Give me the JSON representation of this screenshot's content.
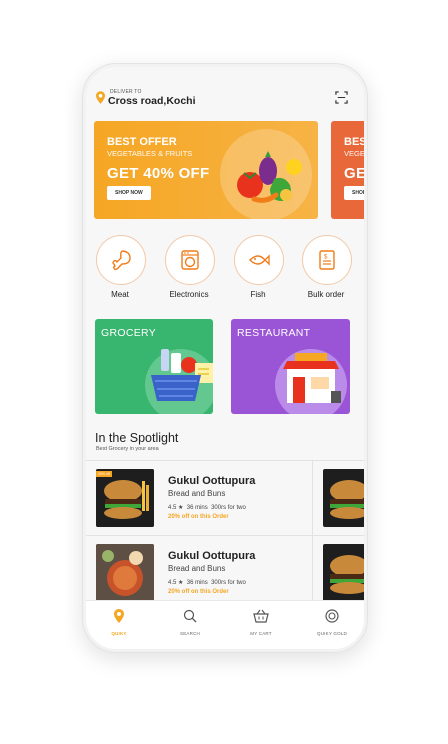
{
  "header": {
    "deliver_label": "DELIVER TO",
    "location": "Cross road,Kochi",
    "pin_icon": "location-pin-icon",
    "scan_icon": "scan-icon"
  },
  "banners": [
    {
      "title": "BEST OFFER",
      "subtitle": "VEGETABLES & FRUITS",
      "discount": "GET 40% OFF",
      "button": "SHOP NOW",
      "color": "#f5a623"
    },
    {
      "title": "BES",
      "subtitle": "VEGE",
      "discount": "GE",
      "button": "SHOP",
      "color": "#e8683a"
    }
  ],
  "categories": [
    {
      "label": "Meat",
      "icon": "drumstick-icon"
    },
    {
      "label": "Electronics",
      "icon": "washing-machine-icon"
    },
    {
      "label": "Fish",
      "icon": "fish-icon"
    },
    {
      "label": "Bulk order",
      "icon": "document-icon"
    }
  ],
  "cards": [
    {
      "title": "GROCERY",
      "color": "#38b56f"
    },
    {
      "title": "RESTAURANT",
      "color": "#9a55d6"
    }
  ],
  "spotlight": {
    "title": "In the Spotlight",
    "subtitle": "Best Grocery in your area"
  },
  "restaurants": [
    {
      "badge": "20% off",
      "name": "Gukul Oottupura",
      "category": "Bread and Buns",
      "rating": "4.5",
      "time": "36 mins",
      "price": "300rs for two",
      "offer": "20% off on this Order"
    },
    {
      "name": "Gukul Oottupura",
      "category": "Bread and Buns",
      "rating": "4.5",
      "time": "36 mins",
      "price": "300rs for two",
      "offer": "20% off on this Order"
    }
  ],
  "nav": [
    {
      "label": "QUIKY",
      "icon": "location-pin-icon",
      "active": true
    },
    {
      "label": "SEARCH",
      "icon": "search-icon",
      "active": false
    },
    {
      "label": "MY CART",
      "icon": "basket-icon",
      "active": false
    },
    {
      "label": "QUIKY GOLD",
      "icon": "gold-coin-icon",
      "active": false
    }
  ],
  "colors": {
    "accent": "#f5a623",
    "grocery": "#38b56f",
    "restaurant": "#9a55d6",
    "banner2": "#e8683a"
  }
}
